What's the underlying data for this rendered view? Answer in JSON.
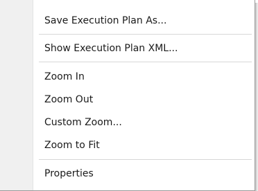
{
  "menu": {
    "items": [
      {
        "label": "Save Execution Plan As..."
      },
      {
        "label": "Show Execution Plan XML..."
      },
      {
        "label": "Zoom In"
      },
      {
        "label": "Zoom Out"
      },
      {
        "label": "Custom Zoom..."
      },
      {
        "label": "Zoom to Fit"
      },
      {
        "label": "Properties"
      }
    ]
  }
}
